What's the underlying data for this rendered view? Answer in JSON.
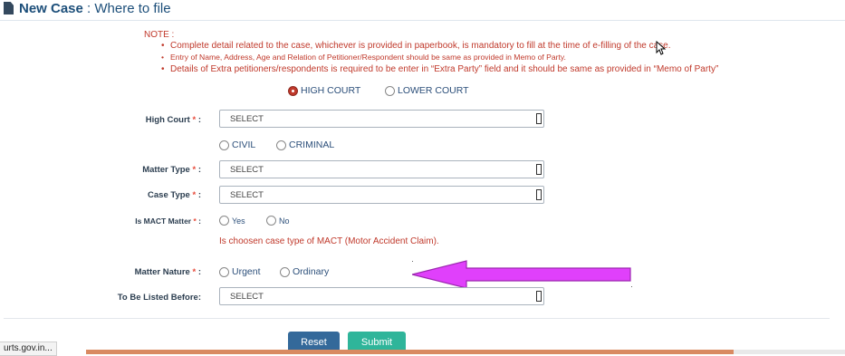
{
  "header": {
    "title_bold": "New Case",
    "title_rest": " : Where to file"
  },
  "note": {
    "label": "NOTE :",
    "items": [
      "Complete detail related to the case, whichever is provided in paperbook, is mandatory to fill at the time of e-filling of the case.",
      "Entry of Name, Address, Age and Relation of Petitioner/Respondent should be same as provided in Memo of Party.",
      "Details of Extra petitioners/respondents is required to be enter in “Extra Party” field and it should be same as provided in “Memo of Party”"
    ]
  },
  "court_type": {
    "options": [
      "HIGH COURT",
      "LOWER COURT"
    ],
    "selected": "HIGH COURT"
  },
  "high_court": {
    "label": "High Court",
    "required": "*",
    "colon": " :",
    "value": "SELECT"
  },
  "case_category": {
    "options": [
      "CIVIL",
      "CRIMINAL"
    ]
  },
  "matter_type": {
    "label": "Matter Type",
    "required": "*",
    "colon": " :",
    "value": "SELECT"
  },
  "case_type": {
    "label": "Case Type",
    "required": "*",
    "colon": " :",
    "value": "SELECT"
  },
  "mact": {
    "label": "Is MACT Matter",
    "required": "*",
    "colon": " :",
    "options": [
      "Yes",
      "No"
    ],
    "info": "Is choosen case type of MACT (Motor Accident Claim)."
  },
  "matter_nature": {
    "label": "Matter Nature",
    "required": "*",
    "colon": " :",
    "options": [
      "Urgent",
      "Ordinary"
    ]
  },
  "listed_before": {
    "label": "To Be Listed Before:",
    "value": "SELECT"
  },
  "buttons": {
    "reset": "Reset",
    "submit": "Submit"
  },
  "status_url": "urts.gov.in...",
  "colors": {
    "accent_red": "#c0392b",
    "reset_blue": "#34699a",
    "submit_teal": "#2fb59a",
    "arrow_magenta": "#e040fb"
  }
}
